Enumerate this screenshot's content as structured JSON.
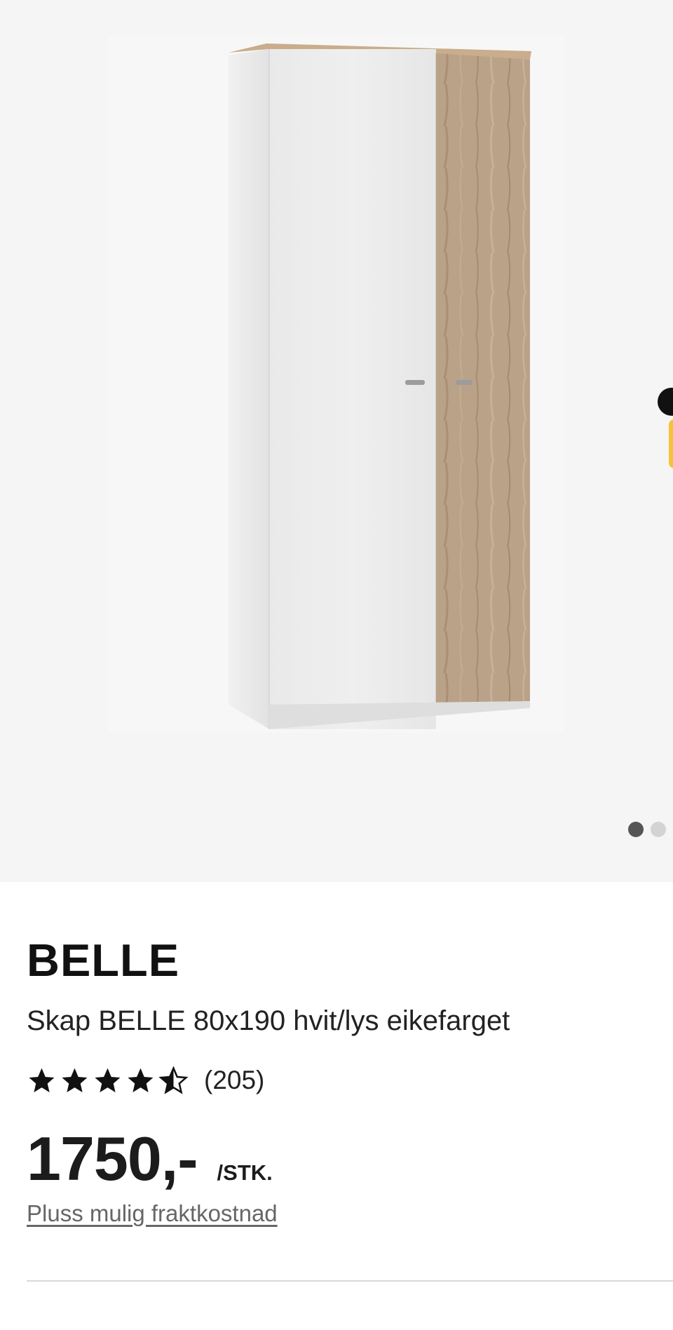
{
  "gallery": {
    "image_alt": "Skap BELLE 80x190 hvit/lys eikefarget",
    "current_slide": 1,
    "total_slides": 2
  },
  "product": {
    "brand": "BELLE",
    "title": "Skap BELLE 80x190 hvit/lys eikefarget",
    "rating": 4.5,
    "rating_max": 5,
    "review_count": "(205)",
    "price": "1750,-",
    "unit": "/STK.",
    "shipping_note": "Pluss mulig fraktkostnad"
  },
  "colors": {
    "gallery_bg": "#f5f5f5",
    "star": "#111111",
    "accent_peek": "#f5c23a"
  }
}
